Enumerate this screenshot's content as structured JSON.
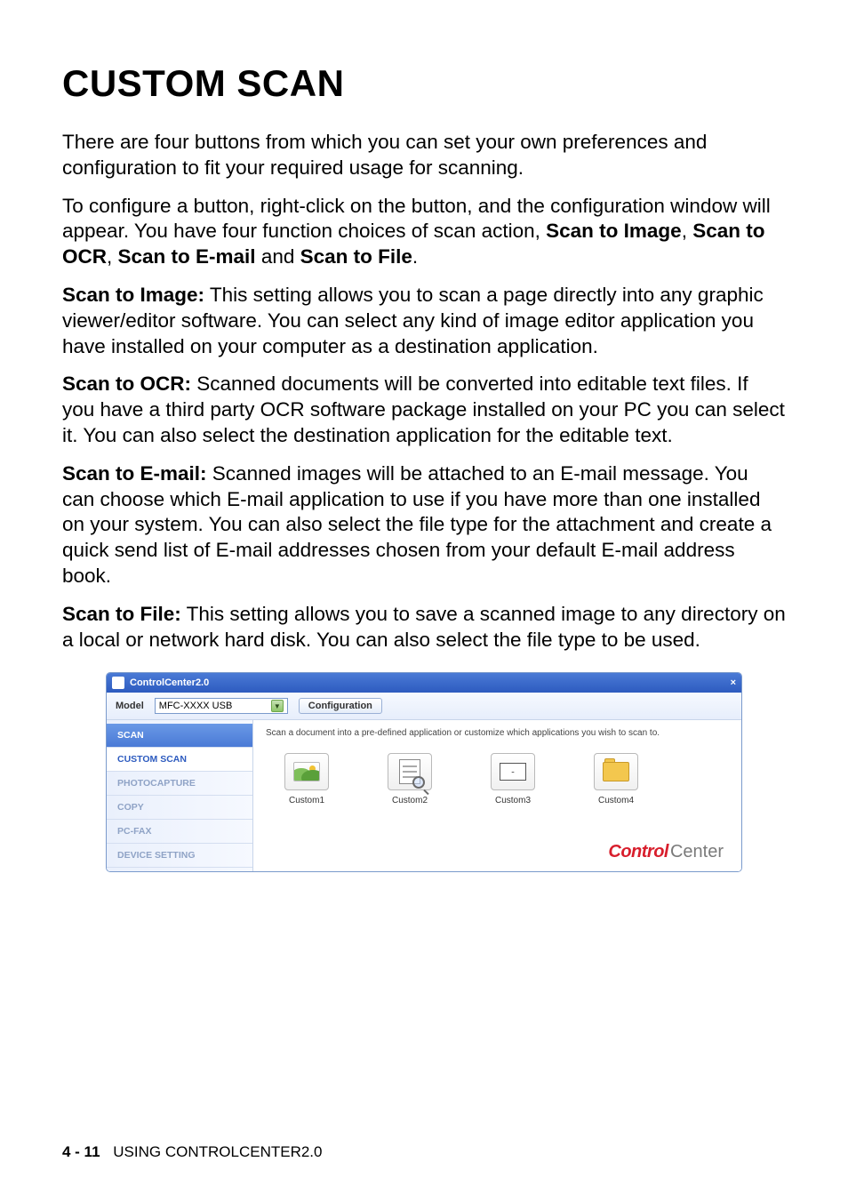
{
  "title": "CUSTOM SCAN",
  "p1": "There are four buttons from which you can set your own preferences and configuration to fit your required usage for scanning.",
  "p2_lead": "To configure a button, right-click on the button, and the configuration window will appear. You have four function choices of scan action, ",
  "p2_b1": "Scan to Image",
  "p2_s1": ", ",
  "p2_b2": "Scan to OCR",
  "p2_s2": ", ",
  "p2_b3": "Scan to E-mail",
  "p2_s3": " and ",
  "p2_b4": "Scan to File",
  "p2_end": ".",
  "p3_head": "Scan to Image:",
  "p3_body": "  This setting allows you to scan a page directly into any graphic viewer/editor software. You can select any kind of image editor application you have installed on your computer as a destination application.",
  "p4_head": "Scan to OCR:",
  "p4_body": "  Scanned documents will be converted into editable text files. If you have a third party OCR software package installed on your PC you can select it. You can also select the destination application for the editable text.",
  "p5_head": "Scan to E-mail:",
  "p5_body": "  Scanned images will be attached to an E-mail message. You can choose which E-mail application to use if you have more than one installed on your system. You can also select the file type for the attachment and create a quick send list of E-mail addresses chosen from your default E-mail address book.",
  "p6_head": "Scan to File:",
  "p6_body": "  This setting allows you to save a scanned image to any directory on a local or network hard disk. You can also select the file type to be used.",
  "app": {
    "title": "ControlCenter2.0",
    "close": "×",
    "model_label": "Model",
    "model_value": "MFC-XXXX USB",
    "config": "Configuration",
    "sidebar": {
      "scan": "SCAN",
      "custom": "CUSTOM SCAN",
      "photo": "PHOTOCAPTURE",
      "copy": "COPY",
      "pcfax": "PC-FAX",
      "device": "DEVICE SETTING"
    },
    "desc": "Scan a document into a pre-defined application or customize which applications you wish to scan to.",
    "buttons": {
      "c1": "Custom1",
      "c2": "Custom2",
      "c3": "Custom3",
      "c4": "Custom4"
    },
    "logo": {
      "control": "Control",
      "center": "Center"
    }
  },
  "footer": {
    "page": "4 - 11",
    "label": "USING CONTROLCENTER2.0"
  }
}
